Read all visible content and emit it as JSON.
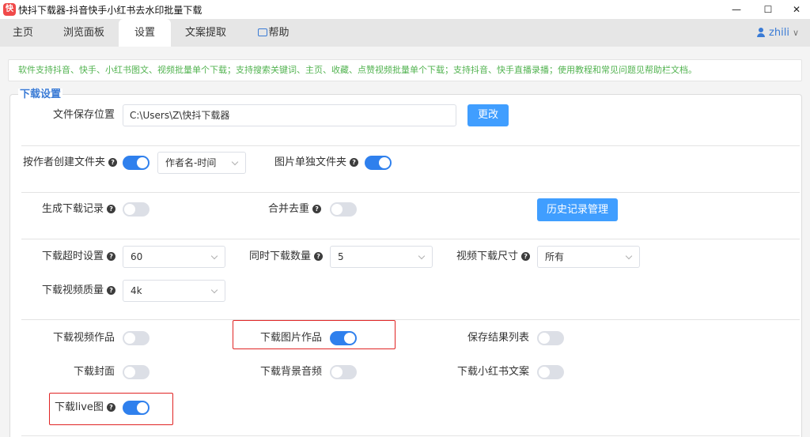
{
  "window": {
    "title": "快抖下载器-抖音快手小红书去水印批量下载",
    "app_icon_glyph": "快",
    "minimize": "—",
    "maximize": "☐",
    "close": "✕"
  },
  "tabs": [
    {
      "label": "主页",
      "active": false
    },
    {
      "label": "浏览面板",
      "active": false
    },
    {
      "label": "设置",
      "active": true
    },
    {
      "label": "文案提取",
      "active": false
    },
    {
      "label": "帮助",
      "active": false,
      "icon": "book-icon"
    }
  ],
  "user": {
    "name": "zhili",
    "icon": "user-icon",
    "chevron": "∨"
  },
  "notice": "软件支持抖音、快手、小红书图文、视频批量单个下载；支持搜索关键词、主页、收藏、点赞视频批量单个下载；支持抖音、快手直播录播；使用教程和常见问题见帮助栏文档。",
  "download_settings": {
    "legend": "下载设置",
    "save_path": {
      "label": "文件保存位置",
      "value": "C:\\Users\\Z\\快抖下载器",
      "change_button": "更改"
    },
    "author_folder": {
      "label": "按作者创建文件夹",
      "on": true,
      "format": "作者名-时间"
    },
    "image_folder": {
      "label": "图片单独文件夹",
      "on": true
    },
    "download_record": {
      "label": "生成下载记录",
      "on": false
    },
    "merge_dedup": {
      "label": "合并去重",
      "on": false
    },
    "history_button": "历史记录管理",
    "timeout": {
      "label": "下载超时设置",
      "value": "60"
    },
    "concurrency": {
      "label": "同时下载数量",
      "value": "5"
    },
    "video_size": {
      "label": "视频下载尺寸",
      "value": "所有"
    },
    "video_quality": {
      "label": "下载视频质量",
      "value": "4k"
    },
    "dl_video": {
      "label": "下载视频作品",
      "on": false
    },
    "dl_images": {
      "label": "下载图片作品",
      "on": true
    },
    "save_results": {
      "label": "保存结果列表",
      "on": false
    },
    "dl_cover": {
      "label": "下载封面",
      "on": false
    },
    "dl_bgm": {
      "label": "下载背景音频",
      "on": false
    },
    "dl_xhs_text": {
      "label": "下载小红书文案",
      "on": false
    },
    "dl_live": {
      "label": "下载live图",
      "on": true
    },
    "help_glyph": "?"
  },
  "colors": {
    "accent": "#409eff",
    "switch_on": "#2f80ed",
    "notice_text": "#52b350",
    "highlight": "#e02424"
  }
}
